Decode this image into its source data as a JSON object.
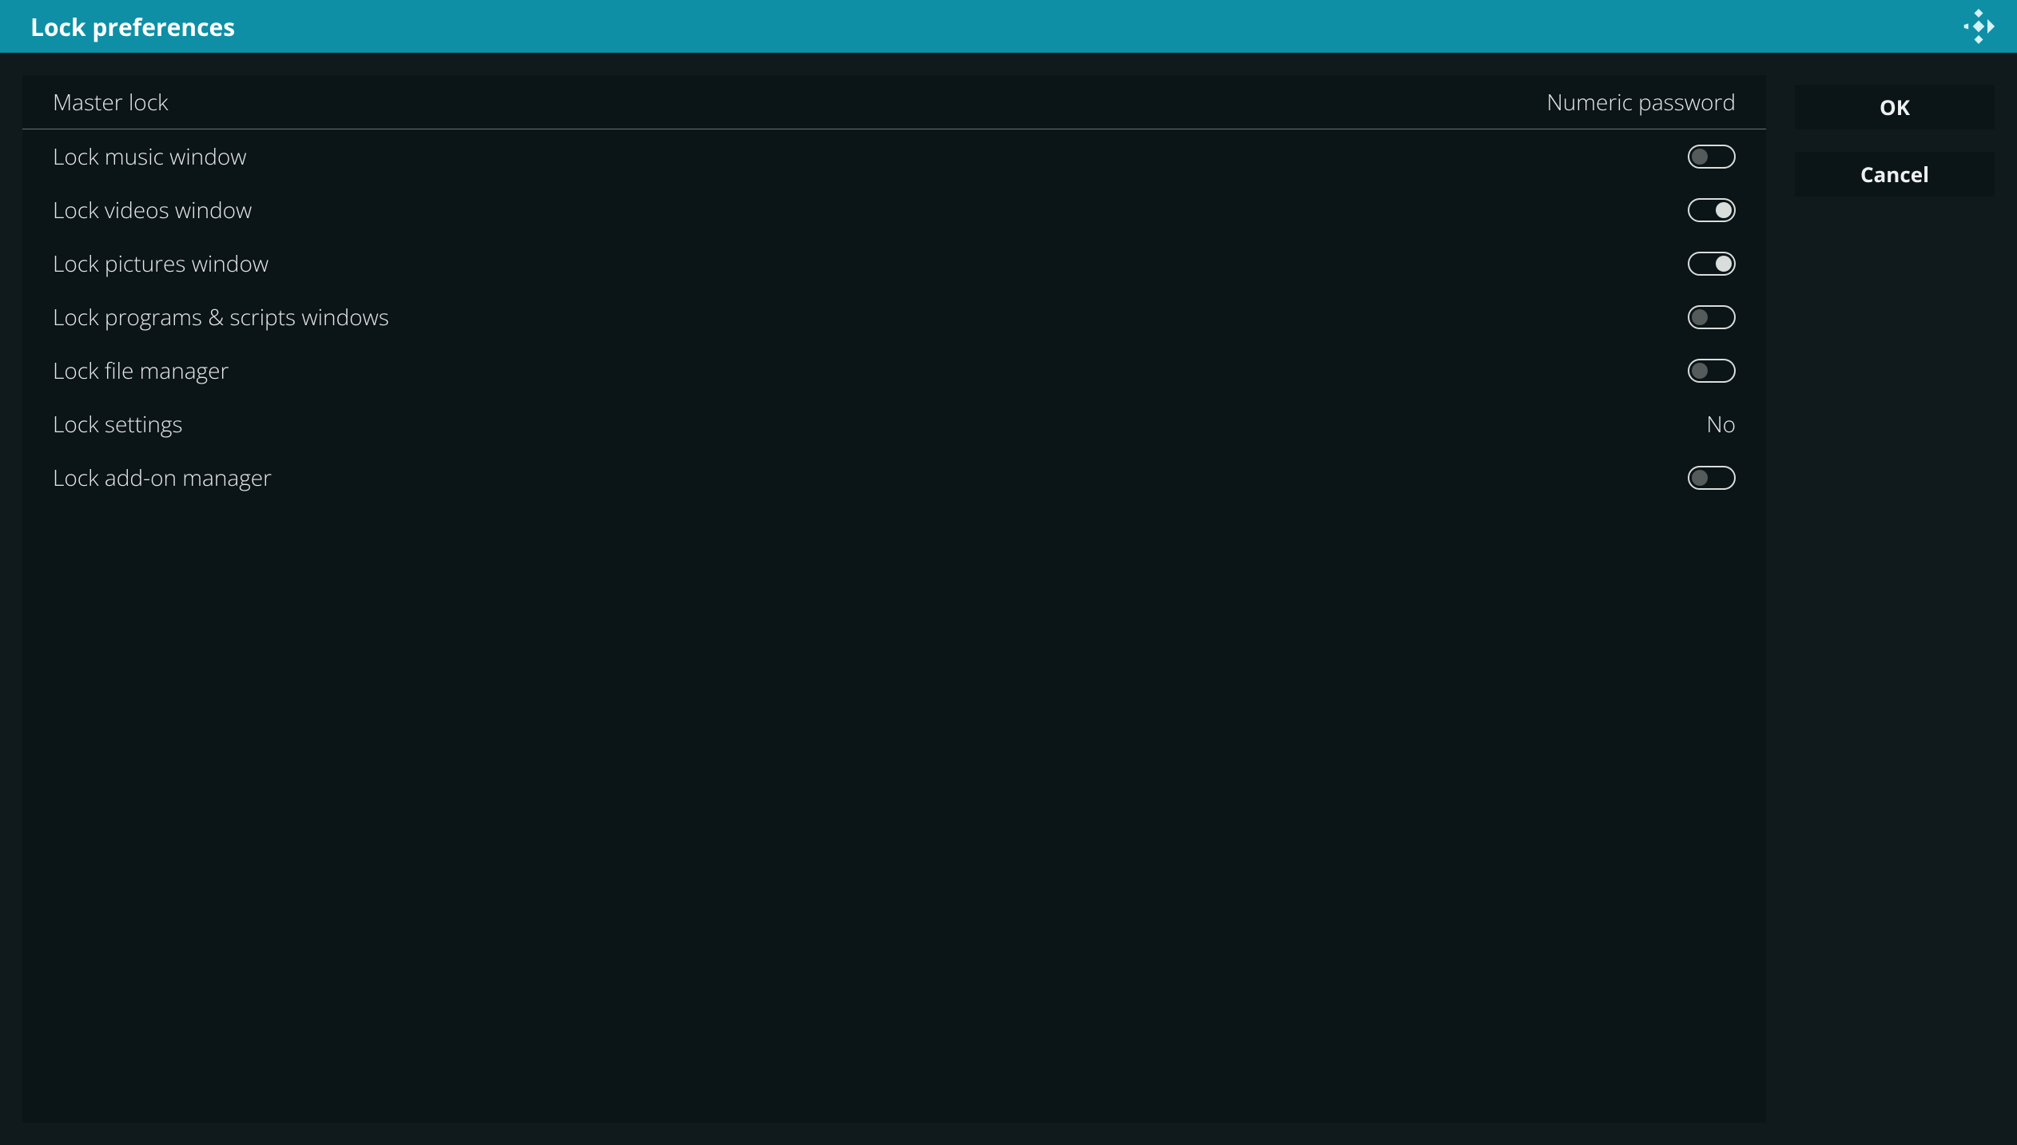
{
  "header": {
    "title": "Lock preferences"
  },
  "settings": {
    "master_lock_label": "Master lock",
    "master_lock_value": "Numeric password",
    "items": [
      {
        "label": "Lock music window",
        "type": "toggle",
        "on": false
      },
      {
        "label": "Lock videos window",
        "type": "toggle",
        "on": true
      },
      {
        "label": "Lock pictures window",
        "type": "toggle",
        "on": true
      },
      {
        "label": "Lock programs & scripts windows",
        "type": "toggle",
        "on": false
      },
      {
        "label": "Lock file manager",
        "type": "toggle",
        "on": false
      },
      {
        "label": "Lock settings",
        "type": "text",
        "value": "No"
      },
      {
        "label": "Lock add-on manager",
        "type": "toggle",
        "on": false
      }
    ]
  },
  "buttons": {
    "ok": "OK",
    "cancel": "Cancel"
  }
}
